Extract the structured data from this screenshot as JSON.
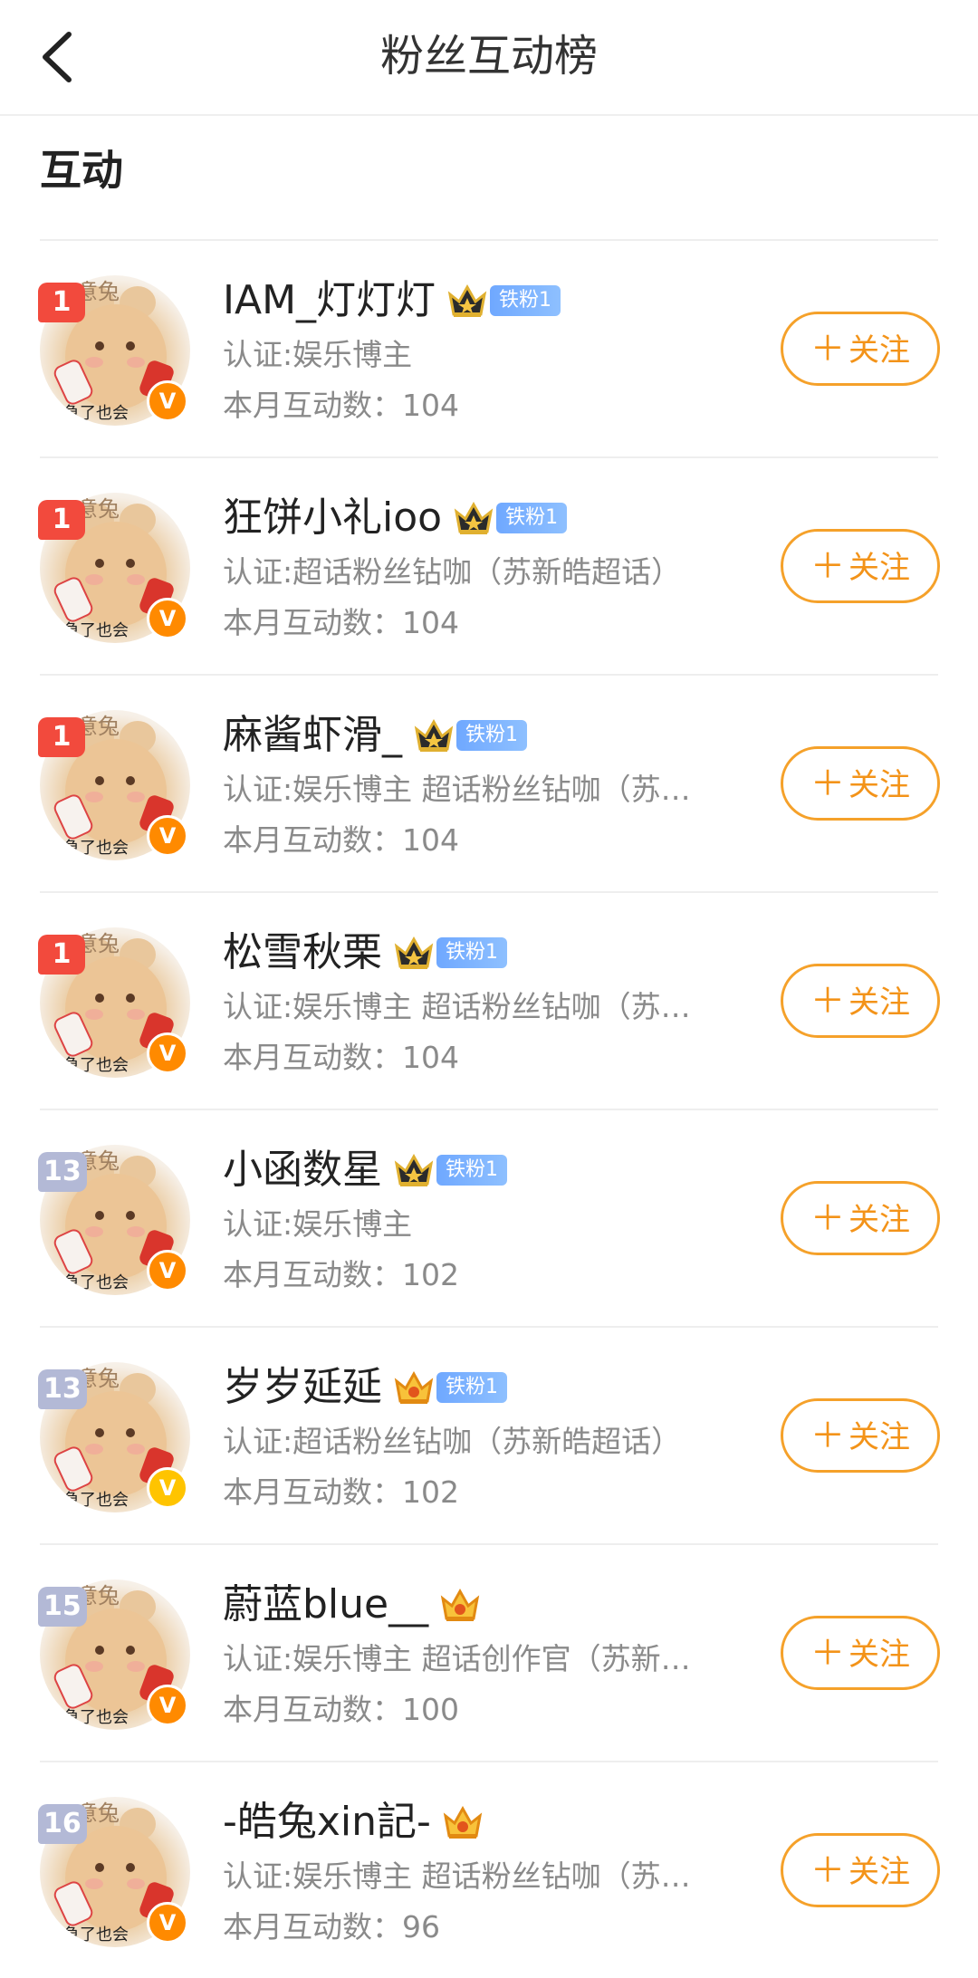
{
  "header": {
    "title": "粉丝互动榜"
  },
  "section": {
    "title": "互动"
  },
  "colors": {
    "accent": "#f39319",
    "rank_top": "#f24a3d",
    "rank_other": "#b3b9d6",
    "fan_badge": "#6fa8ff"
  },
  "avatar_overlay": {
    "top_text": "意兔",
    "bottom_text": "急了也会"
  },
  "rows": [
    {
      "rank": "1",
      "rank_style": "red",
      "name": "IAM_灯灯灯",
      "crown": "crown-dark-icon",
      "badge": "铁粉1",
      "cert": "认证:娱乐博主",
      "count": "本月互动数：104",
      "verify": "V",
      "verify_style": "orange",
      "follow": "关注"
    },
    {
      "rank": "1",
      "rank_style": "red",
      "name": "狂饼小礼ioo",
      "crown": "crown-dark-icon",
      "badge": "铁粉1",
      "cert": "认证:超话粉丝钻咖（苏新皓超话）",
      "count": "本月互动数：104",
      "verify": "V",
      "verify_style": "orange",
      "follow": "关注"
    },
    {
      "rank": "1",
      "rank_style": "red",
      "name": "麻酱虾滑_",
      "crown": "crown-dark-icon",
      "badge": "铁粉1",
      "cert": "认证:娱乐博主 超话粉丝钻咖（苏…",
      "count": "本月互动数：104",
      "verify": "V",
      "verify_style": "orange",
      "follow": "关注"
    },
    {
      "rank": "1",
      "rank_style": "red",
      "name": "松雪秋栗",
      "crown": "crown-dark-icon",
      "badge": "铁粉1",
      "cert": "认证:娱乐博主 超话粉丝钻咖（苏…",
      "count": "本月互动数：104",
      "verify": "V",
      "verify_style": "orange",
      "follow": "关注"
    },
    {
      "rank": "13",
      "rank_style": "gray",
      "name": "小函数星",
      "crown": "crown-dark-icon",
      "badge": "铁粉1",
      "cert": "认证:娱乐博主",
      "count": "本月互动数：102",
      "verify": "V",
      "verify_style": "orange",
      "follow": "关注"
    },
    {
      "rank": "13",
      "rank_style": "gray",
      "name": "岁岁延延",
      "crown": "crown-gold-icon",
      "badge": "铁粉1",
      "cert": "认证:超话粉丝钻咖（苏新皓超话）",
      "count": "本月互动数：102",
      "verify": "V",
      "verify_style": "yellow",
      "follow": "关注"
    },
    {
      "rank": "15",
      "rank_style": "gray",
      "name": "蔚蓝blue__",
      "crown": "crown-gold-icon",
      "badge": "",
      "cert": "认证:娱乐博主 超话创作官（苏新…",
      "count": "本月互动数：100",
      "verify": "V",
      "verify_style": "orange",
      "follow": "关注"
    },
    {
      "rank": "16",
      "rank_style": "gray",
      "name": "-皓兔xin記-",
      "crown": "crown-gold-icon",
      "badge": "",
      "cert": "认证:娱乐博主 超话粉丝钻咖（苏…",
      "count": "本月互动数：96",
      "verify": "V",
      "verify_style": "orange",
      "follow": "关注"
    }
  ]
}
